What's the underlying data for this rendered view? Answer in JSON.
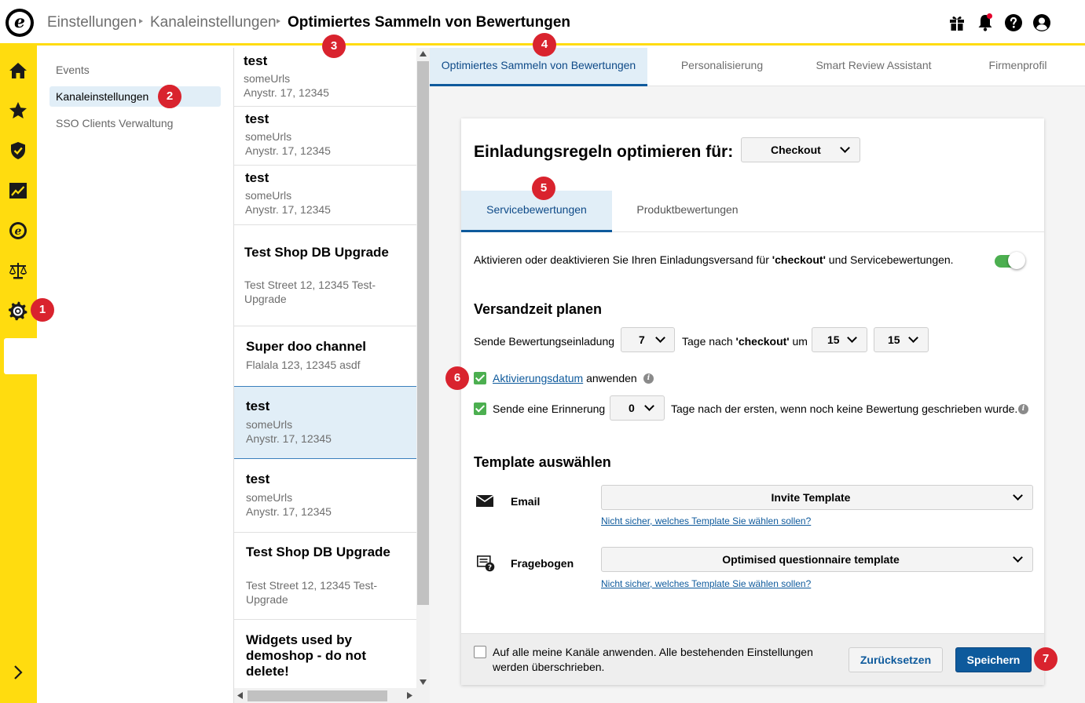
{
  "header": {
    "breadcrumbs": [
      "Einstellungen",
      "Kanaleinstellungen",
      "Optimiertes Sammeln von Bewertungen"
    ],
    "icons": [
      "gift-icon",
      "bell-icon",
      "help-icon",
      "user-icon"
    ]
  },
  "logo_letter": "e",
  "sidebar": {
    "icons": [
      "home-icon",
      "star-icon",
      "shield-icon",
      "chart-icon",
      "e-circle-icon",
      "scales-icon",
      "gear-icon"
    ],
    "expand_icon": "chevron-right-icon"
  },
  "badges": [
    "1",
    "2",
    "3",
    "4",
    "5",
    "6",
    "7"
  ],
  "settings_nav": {
    "items": [
      "Events",
      "Kanaleinstellungen",
      "SSO Clients Verwaltung"
    ],
    "active": "Kanaleinstellungen"
  },
  "channels": [
    {
      "name": "test",
      "line1": "someUrls",
      "line2": "Anystr. 17, 12345"
    },
    {
      "name": "test",
      "line1": "someUrls",
      "line2": "Anystr. 17, 12345"
    },
    {
      "name": "test",
      "line1": "someUrls",
      "line2": "Anystr. 17, 12345"
    },
    {
      "name": "Test Shop DB Upgrade",
      "line1": "Test Street 12, 12345 Test-",
      "line2": "Upgrade"
    },
    {
      "name": "Super doo channel",
      "line1": "Flalala 123, 12345 asdf",
      "line2": ""
    },
    {
      "name": "test",
      "line1": "someUrls",
      "line2": "Anystr. 17, 12345",
      "selected": true
    },
    {
      "name": "test",
      "line1": "someUrls",
      "line2": "Anystr. 17, 12345"
    },
    {
      "name": "Test Shop DB Upgrade",
      "line1": "Test Street 12, 12345 Test-",
      "line2": "Upgrade"
    },
    {
      "name1": "Widgets used by",
      "name2": "demoshop - do not",
      "name3": "delete!"
    }
  ],
  "tabs": [
    "Optimiertes Sammeln von Bewertungen",
    "Personalisierung",
    "Smart Review Assistant",
    "Firmenprofil"
  ],
  "active_tab": "Optimiertes Sammeln von Bewertungen",
  "card": {
    "title": "Einladungsregeln optimieren für:",
    "type_select": "Checkout",
    "subtabs": [
      "Servicebewertungen",
      "Produktbewertungen"
    ],
    "active_subtab": "Servicebewertungen",
    "toggle_text_pre": "Aktivieren oder deaktivieren Sie Ihren Einladungsversand für ",
    "toggle_text_bold": "'checkout'",
    "toggle_text_post": " und Servicebewertungen.",
    "toggle_on": true,
    "schedule_heading": "Versandzeit planen",
    "send_label": "Sende Bewertungseinladung",
    "days_value": "7",
    "days_after_pre": "Tage nach ",
    "days_after_bold": "'checkout'",
    "days_after_post": " um",
    "hour_value": "15",
    "minute_value": "15",
    "activation_link": "Aktivierungsdatum",
    "activation_suffix": "anwenden",
    "activation_checked": true,
    "reminder_label": "Sende eine Erinnerung",
    "reminder_checked": true,
    "reminder_value": "0",
    "reminder_suffix": "Tage nach der ersten, wenn noch keine Bewertung geschrieben wurde.",
    "template_heading": "Template auswählen",
    "email_label": "Email",
    "email_template": "Invite Template",
    "help_link": "Nicht sicher, welches Template Sie wählen sollen?",
    "questionnaire_label": "Fragebogen",
    "questionnaire_template": "Optimised questionnaire template",
    "footer_line1": "Auf alle meine Kanäle anwenden. Alle bestehenden Einstellungen",
    "footer_line2": "werden überschrieben.",
    "footer_checked": false,
    "reset_button": "Zurücksetzen",
    "save_button": "Speichern"
  },
  "colors": {
    "brand_yellow": "#ffdc0f",
    "primary_blue": "#0e5a9c",
    "active_tab_bg": "#e1eef7",
    "toggle_green": "#4caf50",
    "badge_red": "#d9232e"
  }
}
